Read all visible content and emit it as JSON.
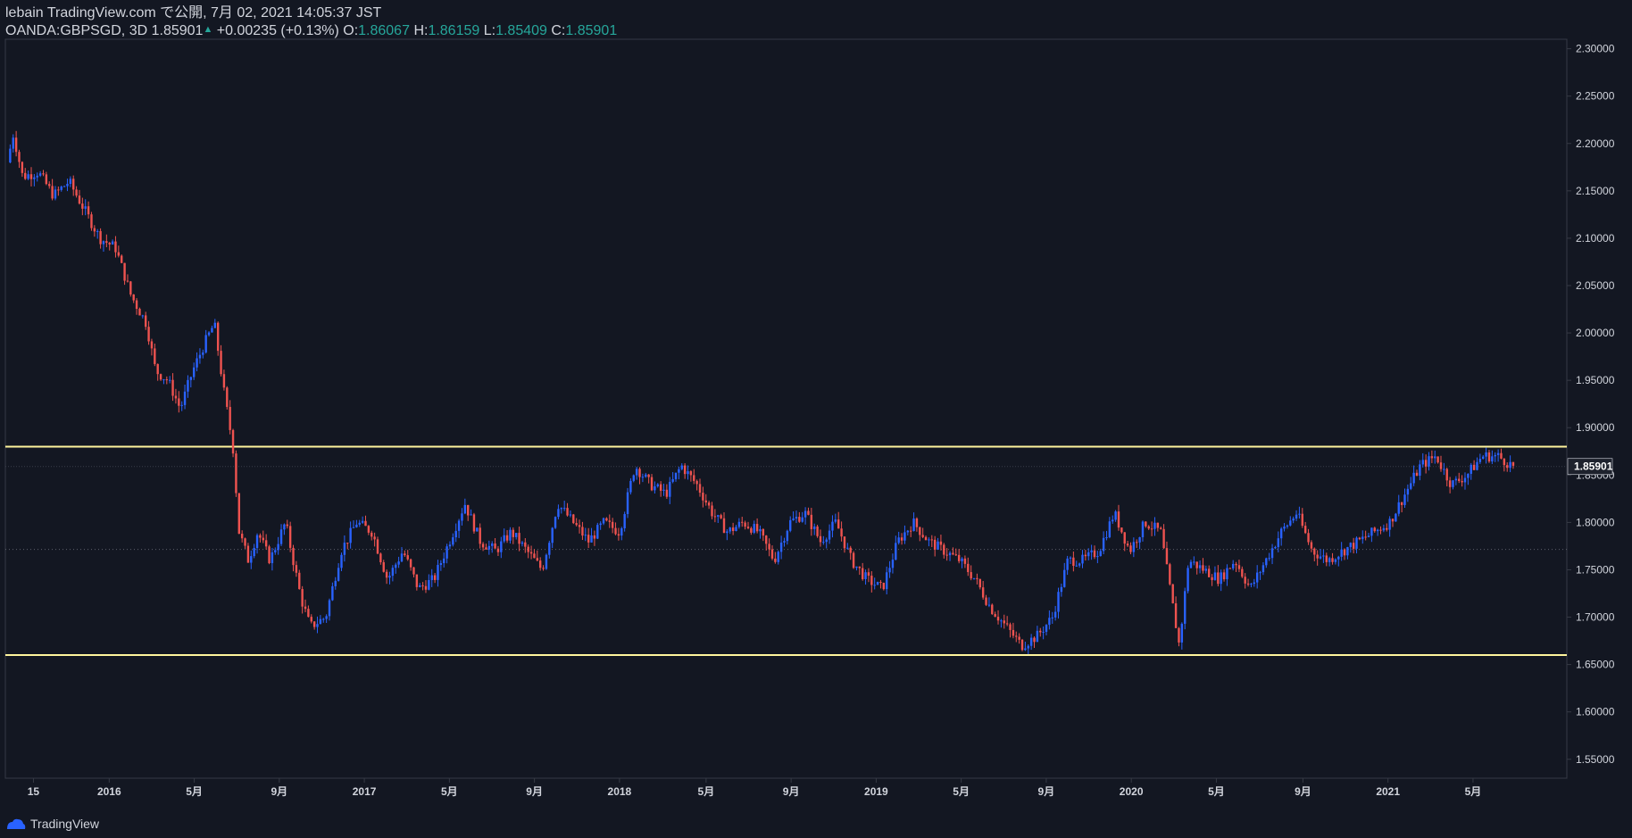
{
  "header": {
    "line1": "lebain TradingView.com で公開, 7月 02, 2021 14:05:37 JST",
    "symbol": "OANDA:GBPSGD, 3D",
    "last": "1.85901",
    "change_arrow": "▲",
    "change": "+0.00235 (+0.13%)",
    "o_label": "O:",
    "o_value": "1.86067",
    "h_label": "H:",
    "h_value": "1.86159",
    "l_label": "L:",
    "l_value": "1.85409",
    "c_label": "C:",
    "c_value": "1.85901"
  },
  "footer": {
    "brand": "TradingView"
  },
  "colors": {
    "background": "#131722",
    "up_candle": "#2962ff",
    "down_candle": "#ef5350",
    "level_line": "#fff59d",
    "grid": "#2a2e39",
    "text": "#d1d4dc",
    "positive": "#26a69a"
  },
  "chart_data": {
    "type": "candlestick",
    "symbol": "OANDA:GBPSGD",
    "interval": "3D",
    "y_axis": {
      "min": 1.53,
      "max": 2.31,
      "ticks": [
        "2.30000",
        "2.25000",
        "2.20000",
        "2.15000",
        "2.10000",
        "2.05000",
        "2.00000",
        "1.95000",
        "1.90000",
        "1.85000",
        "1.80000",
        "1.75000",
        "1.70000",
        "1.65000",
        "1.60000",
        "1.55000"
      ],
      "last_price_label": "1.85901"
    },
    "x_axis": {
      "ticks": [
        {
          "label": "15",
          "pos": 0.017
        },
        {
          "label": "2016",
          "pos": 0.066
        },
        {
          "label": "5月",
          "pos": 0.121
        },
        {
          "label": "9月",
          "pos": 0.176
        },
        {
          "label": "2017",
          "pos": 0.231
        },
        {
          "label": "5月",
          "pos": 0.286
        },
        {
          "label": "9月",
          "pos": 0.341
        },
        {
          "label": "2018",
          "pos": 0.396
        },
        {
          "label": "5月",
          "pos": 0.452
        },
        {
          "label": "9月",
          "pos": 0.507
        },
        {
          "label": "2019",
          "pos": 0.562
        },
        {
          "label": "5月",
          "pos": 0.617
        },
        {
          "label": "9月",
          "pos": 0.672
        },
        {
          "label": "2020",
          "pos": 0.727
        },
        {
          "label": "5月",
          "pos": 0.782
        },
        {
          "label": "9月",
          "pos": 0.838
        },
        {
          "label": "2021",
          "pos": 0.893
        },
        {
          "label": "5月",
          "pos": 0.948
        }
      ]
    },
    "horizontal_levels": [
      1.88,
      1.66
    ],
    "close_anchors": [
      [
        0.0,
        2.18
      ],
      [
        0.004,
        2.21
      ],
      [
        0.01,
        2.165
      ],
      [
        0.02,
        2.17
      ],
      [
        0.03,
        2.145
      ],
      [
        0.04,
        2.16
      ],
      [
        0.05,
        2.13
      ],
      [
        0.06,
        2.1
      ],
      [
        0.07,
        2.09
      ],
      [
        0.08,
        2.04
      ],
      [
        0.09,
        2.01
      ],
      [
        0.096,
        1.96
      ],
      [
        0.104,
        1.95
      ],
      [
        0.112,
        1.92
      ],
      [
        0.12,
        1.96
      ],
      [
        0.128,
        1.99
      ],
      [
        0.134,
        2.01
      ],
      [
        0.14,
        1.94
      ],
      [
        0.146,
        1.88
      ],
      [
        0.15,
        1.79
      ],
      [
        0.156,
        1.76
      ],
      [
        0.162,
        1.79
      ],
      [
        0.17,
        1.76
      ],
      [
        0.18,
        1.8
      ],
      [
        0.19,
        1.72
      ],
      [
        0.196,
        1.69
      ],
      [
        0.206,
        1.7
      ],
      [
        0.216,
        1.77
      ],
      [
        0.226,
        1.8
      ],
      [
        0.236,
        1.79
      ],
      [
        0.246,
        1.74
      ],
      [
        0.256,
        1.77
      ],
      [
        0.266,
        1.73
      ],
      [
        0.276,
        1.74
      ],
      [
        0.286,
        1.78
      ],
      [
        0.296,
        1.82
      ],
      [
        0.306,
        1.78
      ],
      [
        0.316,
        1.77
      ],
      [
        0.326,
        1.79
      ],
      [
        0.336,
        1.77
      ],
      [
        0.346,
        1.75
      ],
      [
        0.356,
        1.82
      ],
      [
        0.366,
        1.8
      ],
      [
        0.376,
        1.78
      ],
      [
        0.386,
        1.8
      ],
      [
        0.396,
        1.79
      ],
      [
        0.406,
        1.86
      ],
      [
        0.416,
        1.84
      ],
      [
        0.426,
        1.83
      ],
      [
        0.436,
        1.86
      ],
      [
        0.446,
        1.84
      ],
      [
        0.456,
        1.81
      ],
      [
        0.466,
        1.79
      ],
      [
        0.476,
        1.8
      ],
      [
        0.486,
        1.79
      ],
      [
        0.496,
        1.76
      ],
      [
        0.506,
        1.8
      ],
      [
        0.516,
        1.81
      ],
      [
        0.526,
        1.78
      ],
      [
        0.536,
        1.8
      ],
      [
        0.546,
        1.76
      ],
      [
        0.556,
        1.74
      ],
      [
        0.566,
        1.73
      ],
      [
        0.576,
        1.78
      ],
      [
        0.586,
        1.8
      ],
      [
        0.596,
        1.78
      ],
      [
        0.606,
        1.77
      ],
      [
        0.616,
        1.76
      ],
      [
        0.626,
        1.74
      ],
      [
        0.636,
        1.71
      ],
      [
        0.646,
        1.69
      ],
      [
        0.656,
        1.67
      ],
      [
        0.666,
        1.68
      ],
      [
        0.676,
        1.7
      ],
      [
        0.686,
        1.76
      ],
      [
        0.696,
        1.76
      ],
      [
        0.706,
        1.77
      ],
      [
        0.716,
        1.81
      ],
      [
        0.726,
        1.77
      ],
      [
        0.736,
        1.8
      ],
      [
        0.746,
        1.79
      ],
      [
        0.752,
        1.73
      ],
      [
        0.758,
        1.67
      ],
      [
        0.764,
        1.76
      ],
      [
        0.774,
        1.75
      ],
      [
        0.784,
        1.74
      ],
      [
        0.794,
        1.76
      ],
      [
        0.804,
        1.73
      ],
      [
        0.814,
        1.76
      ],
      [
        0.824,
        1.79
      ],
      [
        0.834,
        1.81
      ],
      [
        0.844,
        1.77
      ],
      [
        0.854,
        1.76
      ],
      [
        0.864,
        1.77
      ],
      [
        0.874,
        1.78
      ],
      [
        0.884,
        1.79
      ],
      [
        0.894,
        1.8
      ],
      [
        0.904,
        1.83
      ],
      [
        0.914,
        1.86
      ],
      [
        0.924,
        1.87
      ],
      [
        0.934,
        1.84
      ],
      [
        0.944,
        1.85
      ],
      [
        0.954,
        1.87
      ],
      [
        0.964,
        1.87
      ],
      [
        0.974,
        1.859
      ]
    ]
  }
}
